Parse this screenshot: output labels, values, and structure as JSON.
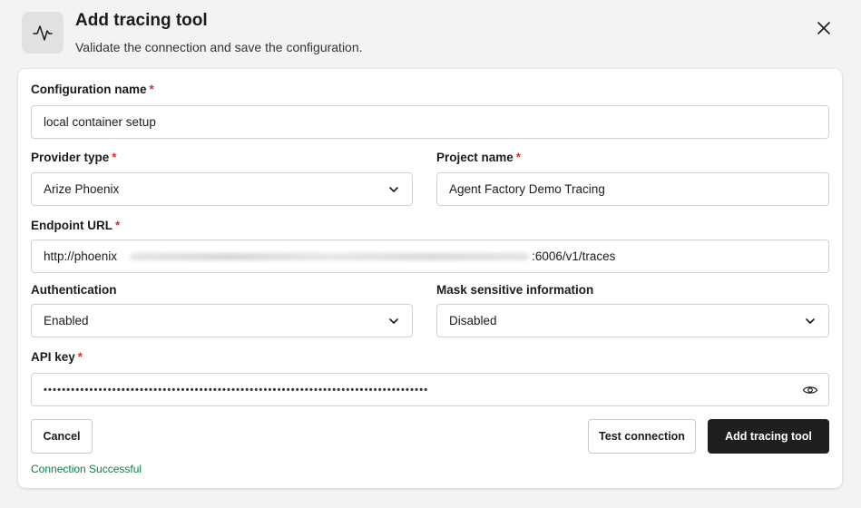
{
  "header": {
    "icon": "activity-pulse-icon",
    "title": "Add tracing tool",
    "subtitle": "Validate the connection and save the configuration.",
    "close_icon": "close-icon"
  },
  "form": {
    "required_marker": "*",
    "config_name": {
      "label": "Configuration name",
      "value": "local container setup"
    },
    "provider_type": {
      "label": "Provider type",
      "value": "Arize Phoenix",
      "icon": "chevron-down-icon"
    },
    "project_name": {
      "label": "Project name",
      "value": "Agent Factory Demo Tracing"
    },
    "endpoint_url": {
      "label": "Endpoint URL",
      "value_prefix": "http://phoenix",
      "value_suffix": ":6006/v1/traces"
    },
    "authentication": {
      "label": "Authentication",
      "value": "Enabled",
      "icon": "chevron-down-icon"
    },
    "mask_sensitive": {
      "label": "Mask sensitive information",
      "value": "Disabled",
      "icon": "chevron-down-icon"
    },
    "api_key": {
      "label": "API key",
      "masked_value": "••••••••••••••••••••••••••••••••••••••••••••••••••••••••••••••••••••••••••••••••••••",
      "icon": "eye-icon"
    }
  },
  "actions": {
    "cancel": "Cancel",
    "test_connection": "Test connection",
    "add_tool": "Add tracing tool"
  },
  "status": {
    "text": "Connection Successful",
    "color": "#107c41"
  },
  "colors": {
    "primary_button": "#1f1f1f",
    "required": "#d13438",
    "background": "#f3f3f3"
  }
}
